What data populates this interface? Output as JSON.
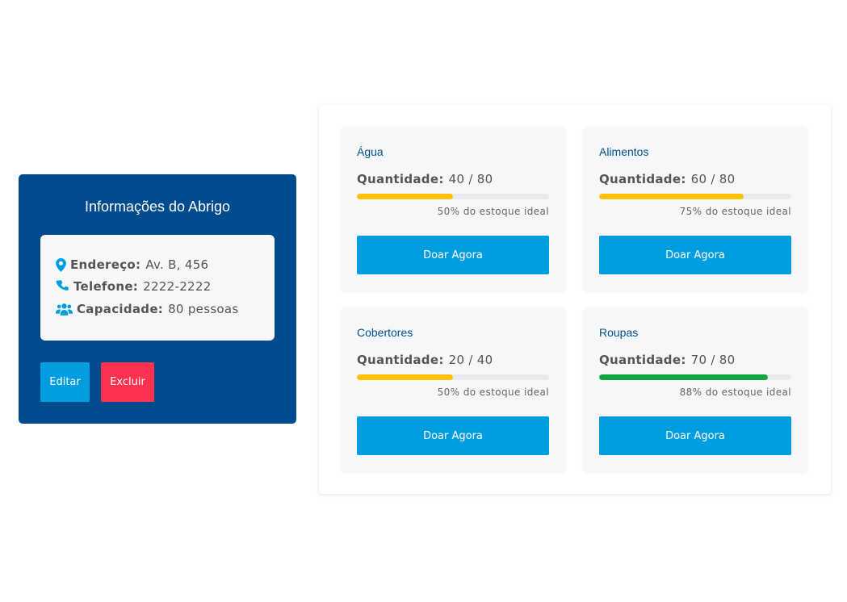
{
  "shelter": {
    "title": "Informações do Abrigo",
    "address_label": "Endereço:",
    "address_value": "Av. B, 456",
    "phone_label": "Telefone:",
    "phone_value": "2222-2222",
    "capacity_label": "Capacidade:",
    "capacity_value": "80 pessoas",
    "edit_label": "Editar",
    "delete_label": "Excluir",
    "icons": [
      "map-pin-icon",
      "phone-icon",
      "users-icon"
    ]
  },
  "colors": {
    "shelter_bg": "#004b8d",
    "accent": "#009ee0",
    "danger": "#ff3350",
    "bar_warning": "#ffc107",
    "bar_success": "#12a643"
  },
  "items": [
    {
      "name": "Água",
      "qty_label": "Quantidade:",
      "qty_value": "40 / 80",
      "percent": 0.5,
      "pct_text": "50% do estoque ideal",
      "bar_color": "#ffc107",
      "button": "Doar Agora"
    },
    {
      "name": "Alimentos",
      "qty_label": "Quantidade:",
      "qty_value": "60 / 80",
      "percent": 0.75,
      "pct_text": "75% do estoque ideal",
      "bar_color": "#ffc107",
      "button": "Doar Agora"
    },
    {
      "name": "Cobertores",
      "qty_label": "Quantidade:",
      "qty_value": "20 / 40",
      "percent": 0.5,
      "pct_text": "50% do estoque ideal",
      "bar_color": "#ffc107",
      "button": "Doar Agora"
    },
    {
      "name": "Roupas",
      "qty_label": "Quantidade:",
      "qty_value": "70 / 80",
      "percent": 0.88,
      "pct_text": "88% do estoque ideal",
      "bar_color": "#12a643",
      "button": "Doar Agora"
    }
  ]
}
